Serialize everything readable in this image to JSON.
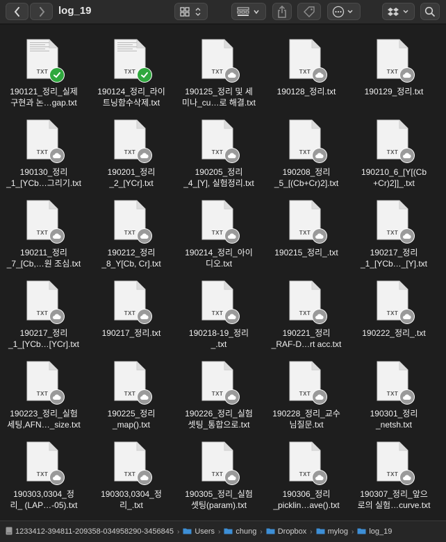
{
  "window": {
    "title": "log_19"
  },
  "toolbar": {
    "colors": {
      "button_bg": "#3a3a3a",
      "icon": "#cfcfcf"
    }
  },
  "files": [
    {
      "line1": "190121_정리_실제",
      "line2": "구현과 논…gap.txt",
      "status": "synced",
      "ext": "TXT"
    },
    {
      "line1": "190124_정리_라이",
      "line2": "트닝함수삭제.txt",
      "status": "synced",
      "ext": "TXT"
    },
    {
      "line1": "190125_정리 및 세",
      "line2": "미나_cu…로 해결.txt",
      "status": "cloud",
      "ext": "TXT"
    },
    {
      "line1": "190128_정리.txt",
      "line2": "",
      "status": "cloud",
      "ext": "TXT"
    },
    {
      "line1": "190129_정리.txt",
      "line2": "",
      "status": "cloud",
      "ext": "TXT"
    },
    {
      "line1": "190130_정리",
      "line2": "_1_[YCb…그리기.txt",
      "status": "cloud",
      "ext": "TXT"
    },
    {
      "line1": "190201_정리",
      "line2": "_2_[YCr].txt",
      "status": "cloud",
      "ext": "TXT"
    },
    {
      "line1": "190205_정리",
      "line2": "_4_[Y], 실험정리.txt",
      "status": "cloud",
      "ext": "TXT"
    },
    {
      "line1": "190208_정리",
      "line2": "_5_[(Cb+Cr)2].txt",
      "status": "cloud",
      "ext": "TXT"
    },
    {
      "line1": "190210_6_[Y[(Cb",
      "line2": "+Cr)2]]_.txt",
      "status": "cloud",
      "ext": "TXT"
    },
    {
      "line1": "190211_정리",
      "line2": "_7_[Cb,…원 조심.txt",
      "status": "cloud",
      "ext": "TXT"
    },
    {
      "line1": "190212_정리",
      "line2": "_8_Y[Cb, Cr].txt",
      "status": "cloud",
      "ext": "TXT"
    },
    {
      "line1": "190214_정리_아이",
      "line2": "디오.txt",
      "status": "cloud",
      "ext": "TXT"
    },
    {
      "line1": "190215_정리_.txt",
      "line2": "",
      "status": "cloud",
      "ext": "TXT"
    },
    {
      "line1": "190217_정리",
      "line2": "_1_[YCb…_[Y].txt",
      "status": "cloud",
      "ext": "TXT"
    },
    {
      "line1": "190217_정리",
      "line2": "_1_[YCb…[YCr].txt",
      "status": "cloud",
      "ext": "TXT"
    },
    {
      "line1": "190217_정리.txt",
      "line2": "",
      "status": "cloud",
      "ext": "TXT"
    },
    {
      "line1": "190218-19_정리",
      "line2": "_.txt",
      "status": "cloud",
      "ext": "TXT"
    },
    {
      "line1": "190221_정리",
      "line2": "_RAF-D…rt acc.txt",
      "status": "cloud",
      "ext": "TXT"
    },
    {
      "line1": "190222_정리_.txt",
      "line2": "",
      "status": "cloud",
      "ext": "TXT"
    },
    {
      "line1": "190223_정리_실험",
      "line2": "세팅,AFN…_size.txt",
      "status": "cloud",
      "ext": "TXT"
    },
    {
      "line1": "190225_정리",
      "line2": "_map().txt",
      "status": "cloud",
      "ext": "TXT"
    },
    {
      "line1": "190226_정리_실험",
      "line2": "셋팅_통합으로.txt",
      "status": "cloud",
      "ext": "TXT"
    },
    {
      "line1": "190228_정리_교수",
      "line2": "님질문.txt",
      "status": "cloud",
      "ext": "TXT"
    },
    {
      "line1": "190301_정리",
      "line2": "_netsh.txt",
      "status": "cloud",
      "ext": "TXT"
    },
    {
      "line1": "190303,0304_정",
      "line2": "리_ (LAP…-05).txt",
      "status": "cloud",
      "ext": "TXT"
    },
    {
      "line1": "190303,0304_정",
      "line2": "리_.txt",
      "status": "cloud",
      "ext": "TXT"
    },
    {
      "line1": "190305_정리_실험",
      "line2": "셋팅(param).txt",
      "status": "cloud",
      "ext": "TXT"
    },
    {
      "line1": "190306_정리",
      "line2": "_picklin…ave().txt",
      "status": "cloud",
      "ext": "TXT"
    },
    {
      "line1": "190307_정리_앞으",
      "line2": "로의 실험…curve.txt",
      "status": "cloud",
      "ext": "TXT"
    }
  ],
  "pathbar": {
    "segments": [
      {
        "label": "1233412-394811-209358-034958290-3456845",
        "icon": "drive-icon"
      },
      {
        "label": "Users",
        "icon": "folder-icon"
      },
      {
        "label": "chung",
        "icon": "folder-icon"
      },
      {
        "label": "Dropbox",
        "icon": "folder-icon"
      },
      {
        "label": "mylog",
        "icon": "folder-icon"
      },
      {
        "label": "log_19",
        "icon": "folder-icon"
      }
    ],
    "separator": "›"
  },
  "colors": {
    "background": "#1e1e1e",
    "synced_badge": "#2fa83e",
    "cloud_badge": "#9a9a9a",
    "folder": "#3d8fd6"
  }
}
